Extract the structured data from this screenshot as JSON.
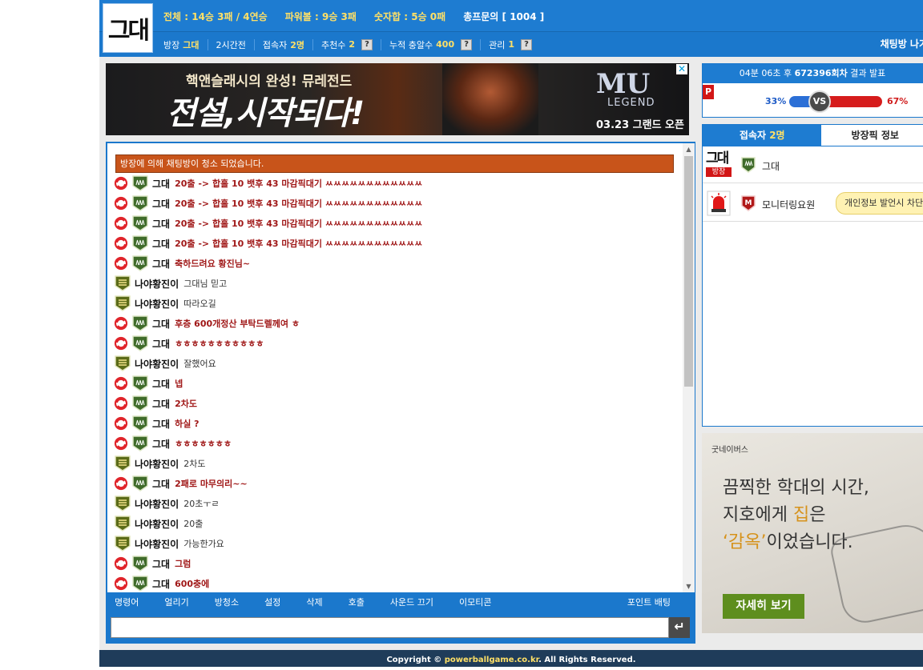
{
  "header": {
    "logo_text": "그대",
    "stats": [
      {
        "label": "전체 : 14승 3패 / 4연승",
        "color": "#ffe066"
      },
      {
        "label": "파워볼 : 9승 3패",
        "color": "#ffe066"
      },
      {
        "label": "숫자합 : 5승 0패",
        "color": "#ffe066"
      },
      {
        "label": "총프문의 [ 1004 ]",
        "color": "#ffffff"
      }
    ],
    "meta": [
      {
        "label": "방장",
        "value": "그대",
        "help": false
      },
      {
        "label": "2시간전",
        "value": "",
        "help": false
      },
      {
        "label": "접속자",
        "value": "2명",
        "help": false
      },
      {
        "label": "추천수",
        "value": "2",
        "help": true
      },
      {
        "label": "누적 충알수",
        "value": "400",
        "help": true
      },
      {
        "label": "관리",
        "value": "1",
        "help": true
      }
    ],
    "help_label": "?",
    "exit_label": "채팅방 나가"
  },
  "ad_top": {
    "line1": "핵앤슬래시의 완성! 뮤레전드",
    "line2": "전설,시작되다!",
    "brand": "MU",
    "brand_sub": "LEGEND",
    "sub": "03.23 그랜드 오픈",
    "close": "✕"
  },
  "chat": {
    "notice": "방장에 의해 채팅방이 청소 되었습니다.",
    "messages": [
      {
        "nick": "그대",
        "text": "20출 -> 합홀 10 뱃후 43 마감픽대기 ㅆㅆㅆㅆㅆㅆㅆㅆㅆㅆㅆㅆ",
        "red": true
      },
      {
        "nick": "그대",
        "text": "20출 -> 합홀 10 뱃후 43 마감픽대기 ㅆㅆㅆㅆㅆㅆㅆㅆㅆㅆㅆㅆ",
        "red": true
      },
      {
        "nick": "그대",
        "text": "20출 -> 합홀 10 뱃후 43 마감픽대기 ㅆㅆㅆㅆㅆㅆㅆㅆㅆㅆㅆㅆ",
        "red": true
      },
      {
        "nick": "그대",
        "text": "20출 -> 합홀 10 뱃후 43 마감픽대기 ㅆㅆㅆㅆㅆㅆㅆㅆㅆㅆㅆㅆ",
        "red": true
      },
      {
        "nick": "그대",
        "text": "축하드려요 황진님~",
        "red": true
      },
      {
        "nick": "나야황진이",
        "text": "그대님 믿고",
        "red": false
      },
      {
        "nick": "나야황진이",
        "text": "따라오길",
        "red": false
      },
      {
        "nick": "그대",
        "text": "후층 600개정산 부탁드렐께여 ㅎ",
        "red": true
      },
      {
        "nick": "그대",
        "text": "ㅎㅎㅎㅎㅎㅎㅎㅎㅎㅎㅎ",
        "red": true
      },
      {
        "nick": "나야황진이",
        "text": "잘했어요",
        "red": false
      },
      {
        "nick": "그대",
        "text": "넵",
        "red": true
      },
      {
        "nick": "그대",
        "text": "2차도",
        "red": true
      },
      {
        "nick": "그대",
        "text": "하실 ?",
        "red": true
      },
      {
        "nick": "그대",
        "text": "ㅎㅎㅎㅎㅎㅎㅎ",
        "red": true
      },
      {
        "nick": "나야황진이",
        "text": "2차도",
        "red": false
      },
      {
        "nick": "그대",
        "text": "2패로 마무의리~~",
        "red": true
      },
      {
        "nick": "나야황진이",
        "text": "20초ㅜㄹ",
        "red": false
      },
      {
        "nick": "나야황진이",
        "text": "20출",
        "red": false
      },
      {
        "nick": "나야황진이",
        "text": "가능한가요",
        "red": false
      },
      {
        "nick": "그대",
        "text": "그럼",
        "red": true
      },
      {
        "nick": "그대",
        "text": "600충에",
        "red": true
      }
    ],
    "menu": [
      "명령어",
      "얼리기",
      "방청소",
      "설정",
      "삭제",
      "호출",
      "사운드 끄기",
      "이모티콘"
    ],
    "point_bet": "포인트 배팅",
    "input_value": "",
    "send_icon": "↵"
  },
  "result": {
    "pre": "04분 06초 후",
    "round": "672396회차",
    "post": "결과 발표",
    "p_icon": "P",
    "left_pct": "33%",
    "right_pct": "67%",
    "vs": "VS",
    "left_ratio": 0.33
  },
  "users": {
    "tab_on_label": "접속자",
    "tab_on_count": "2명",
    "tab_off_label": "방장픽 정보",
    "list": [
      {
        "name": "그대",
        "avatar": "그대",
        "badge": "방장",
        "tip": ""
      },
      {
        "name": "모니터링요원",
        "avatar": "",
        "badge": "",
        "tip": "개인정보 발언시 차단"
      }
    ]
  },
  "ad_side": {
    "brand": "굿네이버스",
    "line1": "끔찍한 학대의 시간,",
    "line2a": "지호에게 ",
    "line2b": "집",
    "line2c": "은",
    "line3a": "‘감옥’",
    "line3b": "이었습니다.",
    "button": "자세히 보기"
  },
  "footer": {
    "pre": "Copyright © ",
    "site": "powerballgame.co.kr",
    "post": ". All Rights Reserved."
  }
}
